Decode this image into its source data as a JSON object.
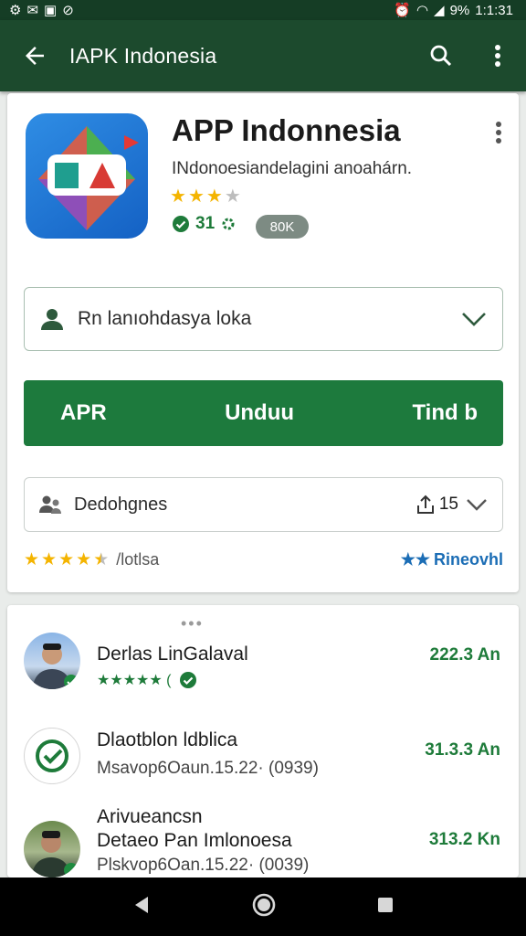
{
  "status_bar": {
    "time": "1:1:31",
    "battery": "9%"
  },
  "app_bar": {
    "title": "IAPK Indonesia"
  },
  "app": {
    "name": "APP Indonnesia",
    "subtitle": "INdonoesiandelagini anoahárn.",
    "rating_stars": 3,
    "rating_max": 4,
    "install_count": "31",
    "size_badge": "80K"
  },
  "account_dropdown": {
    "label": "Rn lanıohdasya loka"
  },
  "action_bar": {
    "left": "APR",
    "center": "Unduu",
    "right": "Tind b"
  },
  "sort_dropdown": {
    "label": "Dedohgnes",
    "count": "15"
  },
  "ratings_row": {
    "stars": 4.5,
    "left_text": "/lotlsa",
    "right_text": "Rineovhl"
  },
  "reviews": [
    {
      "name": "Derlas LinGalaval",
      "meta": "★★★★★ (",
      "amount": "222.3 An"
    },
    {
      "name": "Dlaotblon ldblica",
      "meta": "Msavop6Oaun.15.22· (0939)",
      "amount": "31.3.3 An"
    },
    {
      "name_line1": "Arivueancsn",
      "name_line2": "Detaeo Pan Imlonoesa",
      "meta": "Plskvop6Oan.15.22· (0039)",
      "amount": "313.2 Kn"
    }
  ],
  "colors": {
    "appbar": "#1c4a2d",
    "accent_green": "#1d7a3d",
    "star": "#f4b400"
  }
}
